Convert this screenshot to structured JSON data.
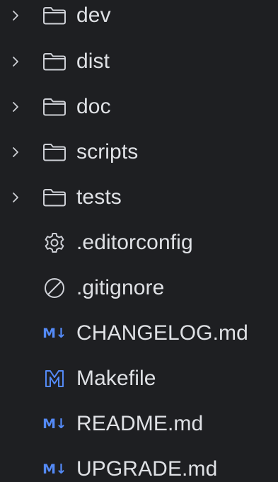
{
  "colors": {
    "background": "#1e1f22",
    "text": "#dfe1e5",
    "icon_gray": "#ced0d6",
    "markdown_blue": "#548af7"
  },
  "items": [
    {
      "label": "dev",
      "type": "folder",
      "icon": "folder-icon",
      "expandable": true
    },
    {
      "label": "dist",
      "type": "folder",
      "icon": "folder-icon",
      "expandable": true
    },
    {
      "label": "doc",
      "type": "folder",
      "icon": "folder-icon",
      "expandable": true
    },
    {
      "label": "scripts",
      "type": "folder",
      "icon": "folder-icon",
      "expandable": true
    },
    {
      "label": "tests",
      "type": "folder",
      "icon": "folder-icon",
      "expandable": true
    },
    {
      "label": ".editorconfig",
      "type": "file",
      "icon": "gear-icon",
      "expandable": false
    },
    {
      "label": ".gitignore",
      "type": "file",
      "icon": "ignore-icon",
      "expandable": false
    },
    {
      "label": "CHANGELOG.md",
      "type": "file",
      "icon": "markdown-icon",
      "badge": "M↓",
      "expandable": false
    },
    {
      "label": "Makefile",
      "type": "file",
      "icon": "makefile-icon",
      "expandable": false
    },
    {
      "label": "README.md",
      "type": "file",
      "icon": "markdown-icon",
      "badge": "M↓",
      "expandable": false
    },
    {
      "label": "UPGRADE.md",
      "type": "file",
      "icon": "markdown-icon",
      "badge": "M↓",
      "expandable": false
    }
  ]
}
